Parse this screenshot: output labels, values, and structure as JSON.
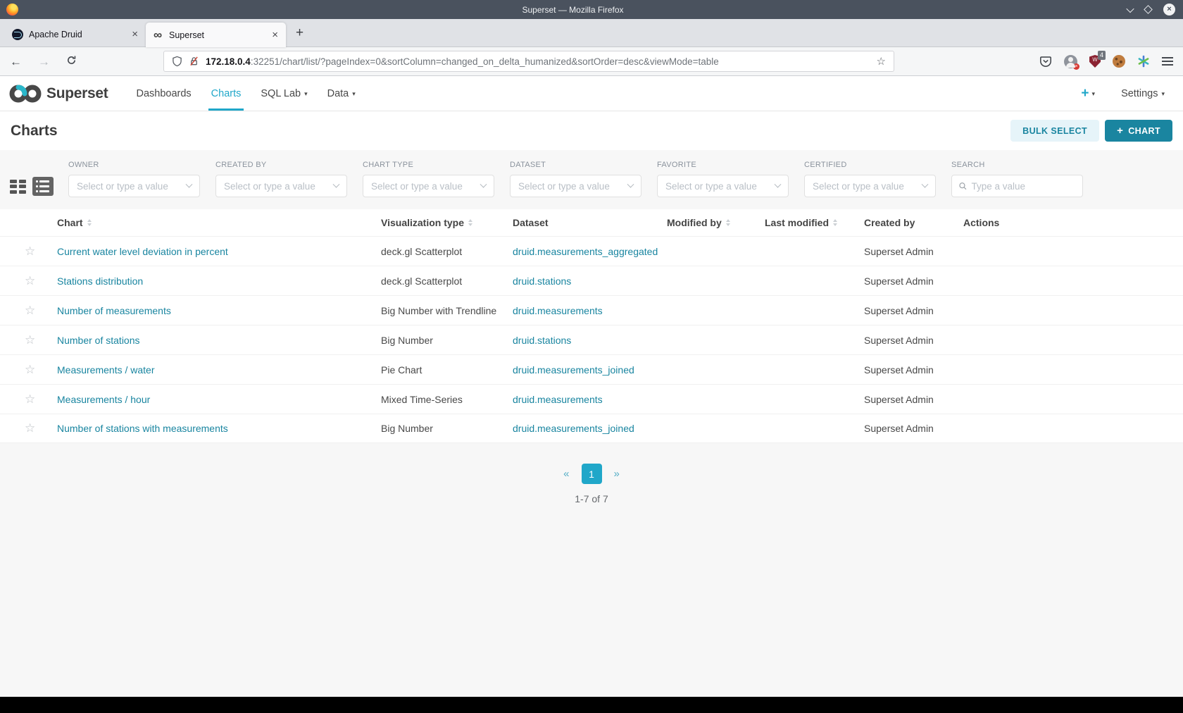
{
  "browser": {
    "window_title": "Superset — Mozilla Firefox",
    "tabs": [
      {
        "title": "Apache Druid"
      },
      {
        "title": "Superset"
      }
    ],
    "url": {
      "host": "172.18.0.4",
      "path": ":32251/chart/list/?pageIndex=0&sortColumn=changed_on_delta_humanized&sortOrder=desc&viewMode=table"
    },
    "adblock_badge": "4"
  },
  "navbar": {
    "brand": "Superset",
    "items": [
      {
        "label": "Dashboards"
      },
      {
        "label": "Charts"
      },
      {
        "label": "SQL Lab"
      },
      {
        "label": "Data"
      }
    ],
    "plus": "+",
    "settings": "Settings"
  },
  "page": {
    "title": "Charts",
    "bulk_select": "BULK SELECT",
    "new_chart": "CHART"
  },
  "filters": {
    "selects": [
      {
        "label": "OWNER",
        "placeholder": "Select or type a value"
      },
      {
        "label": "CREATED BY",
        "placeholder": "Select or type a value"
      },
      {
        "label": "CHART TYPE",
        "placeholder": "Select or type a value"
      },
      {
        "label": "DATASET",
        "placeholder": "Select or type a value"
      },
      {
        "label": "FAVORITE",
        "placeholder": "Select or type a value"
      },
      {
        "label": "CERTIFIED",
        "placeholder": "Select or type a value"
      }
    ],
    "search": {
      "label": "SEARCH",
      "placeholder": "Type a value"
    }
  },
  "table": {
    "columns": [
      {
        "label": "Chart",
        "sortable": true
      },
      {
        "label": "Visualization type",
        "sortable": true
      },
      {
        "label": "Dataset",
        "sortable": false
      },
      {
        "label": "Modified by",
        "sortable": true
      },
      {
        "label": "Last modified",
        "sortable": true
      },
      {
        "label": "Created by",
        "sortable": false
      },
      {
        "label": "Actions",
        "sortable": false
      }
    ],
    "rows": [
      {
        "chart": "Current water level deviation in percent",
        "viz": "deck.gl Scatterplot",
        "dataset": "druid.measurements_aggregated",
        "modified_by": "",
        "last_modified": "",
        "created_by": "Superset Admin"
      },
      {
        "chart": "Stations distribution",
        "viz": "deck.gl Scatterplot",
        "dataset": "druid.stations",
        "modified_by": "",
        "last_modified": "",
        "created_by": "Superset Admin"
      },
      {
        "chart": "Number of measurements",
        "viz": "Big Number with Trendline",
        "dataset": "druid.measurements",
        "modified_by": "",
        "last_modified": "",
        "created_by": "Superset Admin"
      },
      {
        "chart": "Number of stations",
        "viz": "Big Number",
        "dataset": "druid.stations",
        "modified_by": "",
        "last_modified": "",
        "created_by": "Superset Admin"
      },
      {
        "chart": "Measurements / water",
        "viz": "Pie Chart",
        "dataset": "druid.measurements_joined",
        "modified_by": "",
        "last_modified": "",
        "created_by": "Superset Admin"
      },
      {
        "chart": "Measurements / hour",
        "viz": "Mixed Time-Series",
        "dataset": "druid.measurements",
        "modified_by": "",
        "last_modified": "",
        "created_by": "Superset Admin"
      },
      {
        "chart": "Number of stations with measurements",
        "viz": "Big Number",
        "dataset": "druid.measurements_joined",
        "modified_by": "",
        "last_modified": "",
        "created_by": "Superset Admin"
      }
    ]
  },
  "pagination": {
    "prev": "«",
    "current": "1",
    "next": "»",
    "summary": "1-7 of 7"
  },
  "icons": {
    "star": "☆",
    "caret": "▾",
    "close": "×",
    "plus": "+",
    "back": "←",
    "forward": "→",
    "bookmark": "☆"
  },
  "colors": {
    "primary": "#20a7c9",
    "link": "#1985a0",
    "button_bg": "#1a85a0",
    "bulk_bg": "#e6f4f9"
  }
}
